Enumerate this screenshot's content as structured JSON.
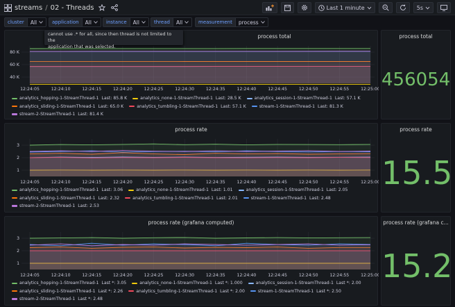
{
  "topbar": {
    "breadcrumb_folder": "streams",
    "breadcrumb_separator": "/",
    "dashboard_title": "02 - Threads",
    "time_range": "Last 1 minute",
    "refresh_interval": "5s"
  },
  "variables": [
    {
      "label": "cluster",
      "value": "All"
    },
    {
      "label": "application",
      "value": "All"
    },
    {
      "label": "instance",
      "value": "All"
    },
    {
      "label": "thread",
      "value": "All"
    },
    {
      "label": "measurement",
      "value": "process"
    }
  ],
  "tooltip": {
    "line1": "cannot use .* for all, since then thread is not limited to the",
    "line2": "application that was selected."
  },
  "colors": {
    "accent_green": "#73bf69",
    "link_blue": "#6e9fff",
    "series_1": "#73bf69",
    "series_2": "#f2cc0c",
    "series_3": "#8ab8ff",
    "series_4": "#ff780a",
    "series_5": "#f2495c",
    "series_6": "#5794f2",
    "series_7": "#b877d9"
  },
  "x_ticks": [
    "12:24:05",
    "12:24:10",
    "12:24:15",
    "12:24:20",
    "12:24:25",
    "12:24:30",
    "12:24:35",
    "12:24:40",
    "12:24:45",
    "12:24:50",
    "12:24:55",
    "12:25:00"
  ],
  "panels": [
    {
      "title": "process total",
      "y_ticks": [
        "80 K",
        "60 K",
        "40 K"
      ],
      "legend": [
        {
          "name": "analytics_hopping-1-StreamThread-1",
          "stat": "Last: 85.8 K"
        },
        {
          "name": "analytics_none-1-StreamThread-1",
          "stat": "Last: 28.5 K"
        },
        {
          "name": "analytics_session-1-StreamThread-1",
          "stat": "Last: 57.1 K"
        },
        {
          "name": "analytics_sliding-1-StreamThread-1",
          "stat": "Last: 65.0 K"
        },
        {
          "name": "analytics_tumbling-1-StreamThread-1",
          "stat": "Last: 57.1 K"
        },
        {
          "name": "stream-1-StreamThread-1",
          "stat": "Last: 81.3 K"
        },
        {
          "name": "stream-2-StreamThread-1",
          "stat": "Last: 81.4 K"
        }
      ]
    },
    {
      "title": "process rate",
      "y_ticks": [
        "3",
        "2",
        "1"
      ],
      "legend": [
        {
          "name": "analytics_hopping-1-StreamThread-1",
          "stat": "Last: 3.06"
        },
        {
          "name": "analytics_none-1-StreamThread-1",
          "stat": "Last: 1.01"
        },
        {
          "name": "analytics_session-1-StreamThread-1",
          "stat": "Last: 2.05"
        },
        {
          "name": "analytics_sliding-1-StreamThread-1",
          "stat": "Last: 2.32"
        },
        {
          "name": "analytics_tumbling-1-StreamThread-1",
          "stat": "Last: 2.01"
        },
        {
          "name": "stream-1-StreamThread-1",
          "stat": "Last: 2.48"
        },
        {
          "name": "stream-2-StreamThread-1",
          "stat": "Last: 2.53"
        }
      ]
    },
    {
      "title": "process rate (grafana computed)",
      "y_ticks": [
        "3",
        "2",
        "1"
      ],
      "legend": [
        {
          "name": "analytics_hopping-1-StreamThread-1",
          "stat": "Last *: 3.05"
        },
        {
          "name": "analytics_none-1-StreamThread-1",
          "stat": "Last *: 1.000"
        },
        {
          "name": "analytics_session-1-StreamThread-1",
          "stat": "Last *: 2.00"
        },
        {
          "name": "analytics_sliding-1-StreamThread-1",
          "stat": "Last *: 2.26"
        },
        {
          "name": "analytics_tumbling-1-StreamThread-1",
          "stat": "Last *: 2.00"
        },
        {
          "name": "stream-1-StreamThread-1",
          "stat": "Last *: 2.50"
        },
        {
          "name": "stream-2-StreamThread-1",
          "stat": "Last *: 2.48"
        }
      ]
    }
  ],
  "stats": [
    {
      "title": "process total",
      "value": "456054"
    },
    {
      "title": "process rate",
      "value": "15.5"
    },
    {
      "title": "process rate (grafana c...",
      "value": "15.2"
    }
  ],
  "chart_data": [
    {
      "type": "line",
      "title": "process total",
      "x": [
        "12:24:05",
        "12:24:10",
        "12:24:15",
        "12:24:20",
        "12:24:25",
        "12:24:30",
        "12:24:35",
        "12:24:40",
        "12:24:45",
        "12:24:50",
        "12:24:55",
        "12:25:00"
      ],
      "ylim": [
        30000,
        90000
      ],
      "series": [
        {
          "name": "analytics_hopping-1-StreamThread-1",
          "values": [
            85600,
            85620,
            85640,
            85660,
            85670,
            85690,
            85710,
            85730,
            85750,
            85770,
            85790,
            85800
          ]
        },
        {
          "name": "analytics_none-1-StreamThread-1",
          "values": [
            28450,
            28455,
            28460,
            28465,
            28470,
            28475,
            28480,
            28485,
            28490,
            28495,
            28498,
            28500
          ]
        },
        {
          "name": "analytics_session-1-StreamThread-1",
          "values": [
            57000,
            57010,
            57020,
            57030,
            57040,
            57050,
            57060,
            57070,
            57080,
            57090,
            57095,
            57100
          ]
        },
        {
          "name": "analytics_sliding-1-StreamThread-1",
          "values": [
            64900,
            64910,
            64920,
            64930,
            64940,
            64950,
            64960,
            64970,
            64980,
            64990,
            64995,
            65000
          ]
        },
        {
          "name": "analytics_tumbling-1-StreamThread-1",
          "values": [
            57000,
            57010,
            57020,
            57030,
            57040,
            57050,
            57060,
            57070,
            57080,
            57090,
            57095,
            57100
          ]
        },
        {
          "name": "stream-1-StreamThread-1",
          "values": [
            81150,
            81165,
            81180,
            81195,
            81210,
            81225,
            81240,
            81255,
            81270,
            81285,
            81295,
            81300
          ]
        },
        {
          "name": "stream-2-StreamThread-1",
          "values": [
            81250,
            81265,
            81280,
            81295,
            81310,
            81325,
            81340,
            81355,
            81370,
            81385,
            81395,
            81400
          ]
        }
      ]
    },
    {
      "type": "line",
      "title": "process rate",
      "x": [
        "12:24:05",
        "12:24:10",
        "12:24:15",
        "12:24:20",
        "12:24:25",
        "12:24:30",
        "12:24:35",
        "12:24:40",
        "12:24:45",
        "12:24:50",
        "12:24:55",
        "12:25:00"
      ],
      "ylim": [
        0.5,
        3.5
      ],
      "series": [
        {
          "name": "analytics_hopping-1-StreamThread-1",
          "values": [
            3.0,
            3.05,
            3.02,
            3.06,
            3.1,
            3.04,
            3.08,
            3.02,
            3.06,
            3.05,
            3.04,
            3.06
          ]
        },
        {
          "name": "analytics_none-1-StreamThread-1",
          "values": [
            1.0,
            1.01,
            1.0,
            1.01,
            1.0,
            1.01,
            1.0,
            1.01,
            1.0,
            1.01,
            1.0,
            1.01
          ]
        },
        {
          "name": "analytics_session-1-StreamThread-1",
          "values": [
            2.0,
            2.05,
            2.02,
            2.06,
            2.03,
            2.05,
            2.02,
            2.04,
            2.05,
            2.03,
            2.04,
            2.05
          ]
        },
        {
          "name": "analytics_sliding-1-StreamThread-1",
          "values": [
            2.3,
            2.35,
            2.28,
            2.4,
            2.3,
            2.25,
            2.35,
            2.3,
            2.33,
            2.28,
            2.3,
            2.32
          ]
        },
        {
          "name": "analytics_tumbling-1-StreamThread-1",
          "values": [
            2.0,
            2.02,
            1.98,
            2.01,
            2.0,
            2.02,
            2.0,
            1.99,
            2.01,
            2.0,
            2.02,
            2.01
          ]
        },
        {
          "name": "stream-1-StreamThread-1",
          "values": [
            2.45,
            2.5,
            2.55,
            2.45,
            2.5,
            2.52,
            2.48,
            2.55,
            2.5,
            2.46,
            2.5,
            2.48
          ]
        },
        {
          "name": "stream-2-StreamThread-1",
          "values": [
            2.5,
            2.55,
            2.5,
            2.58,
            2.52,
            2.5,
            2.55,
            2.5,
            2.53,
            2.56,
            2.5,
            2.53
          ]
        }
      ]
    },
    {
      "type": "line",
      "title": "process rate (grafana computed)",
      "x": [
        "12:24:05",
        "12:24:10",
        "12:24:15",
        "12:24:20",
        "12:24:25",
        "12:24:30",
        "12:24:35",
        "12:24:40",
        "12:24:45",
        "12:24:50",
        "12:24:55",
        "12:25:00"
      ],
      "ylim": [
        0.5,
        3.5
      ],
      "series": [
        {
          "name": "analytics_hopping-1-StreamThread-1",
          "values": [
            3.0,
            3.02,
            3.05,
            3.0,
            3.04,
            3.06,
            3.0,
            3.03,
            3.05,
            3.02,
            3.04,
            3.05
          ]
        },
        {
          "name": "analytics_none-1-StreamThread-1",
          "values": [
            1.0,
            1.0,
            1.0,
            1.0,
            1.0,
            1.0,
            1.0,
            1.0,
            1.0,
            1.0,
            1.0,
            1.0
          ]
        },
        {
          "name": "analytics_session-1-StreamThread-1",
          "values": [
            2.0,
            2.0,
            2.0,
            2.0,
            2.0,
            2.0,
            2.0,
            2.0,
            2.0,
            2.0,
            2.0,
            2.0
          ]
        },
        {
          "name": "analytics_sliding-1-StreamThread-1",
          "values": [
            2.25,
            2.3,
            2.2,
            2.28,
            2.3,
            2.22,
            2.27,
            2.25,
            2.3,
            2.2,
            2.26,
            2.26
          ]
        },
        {
          "name": "analytics_tumbling-1-StreamThread-1",
          "values": [
            2.0,
            2.0,
            2.0,
            2.0,
            2.0,
            2.0,
            2.0,
            2.0,
            2.0,
            2.0,
            2.0,
            2.0
          ]
        },
        {
          "name": "stream-1-StreamThread-1",
          "values": [
            2.5,
            2.4,
            2.6,
            2.45,
            2.55,
            2.5,
            2.4,
            2.6,
            2.5,
            2.45,
            2.55,
            2.5
          ]
        },
        {
          "name": "stream-2-StreamThread-1",
          "values": [
            2.45,
            2.55,
            2.4,
            2.5,
            2.45,
            2.55,
            2.5,
            2.45,
            2.5,
            2.55,
            2.45,
            2.48
          ]
        }
      ]
    }
  ]
}
